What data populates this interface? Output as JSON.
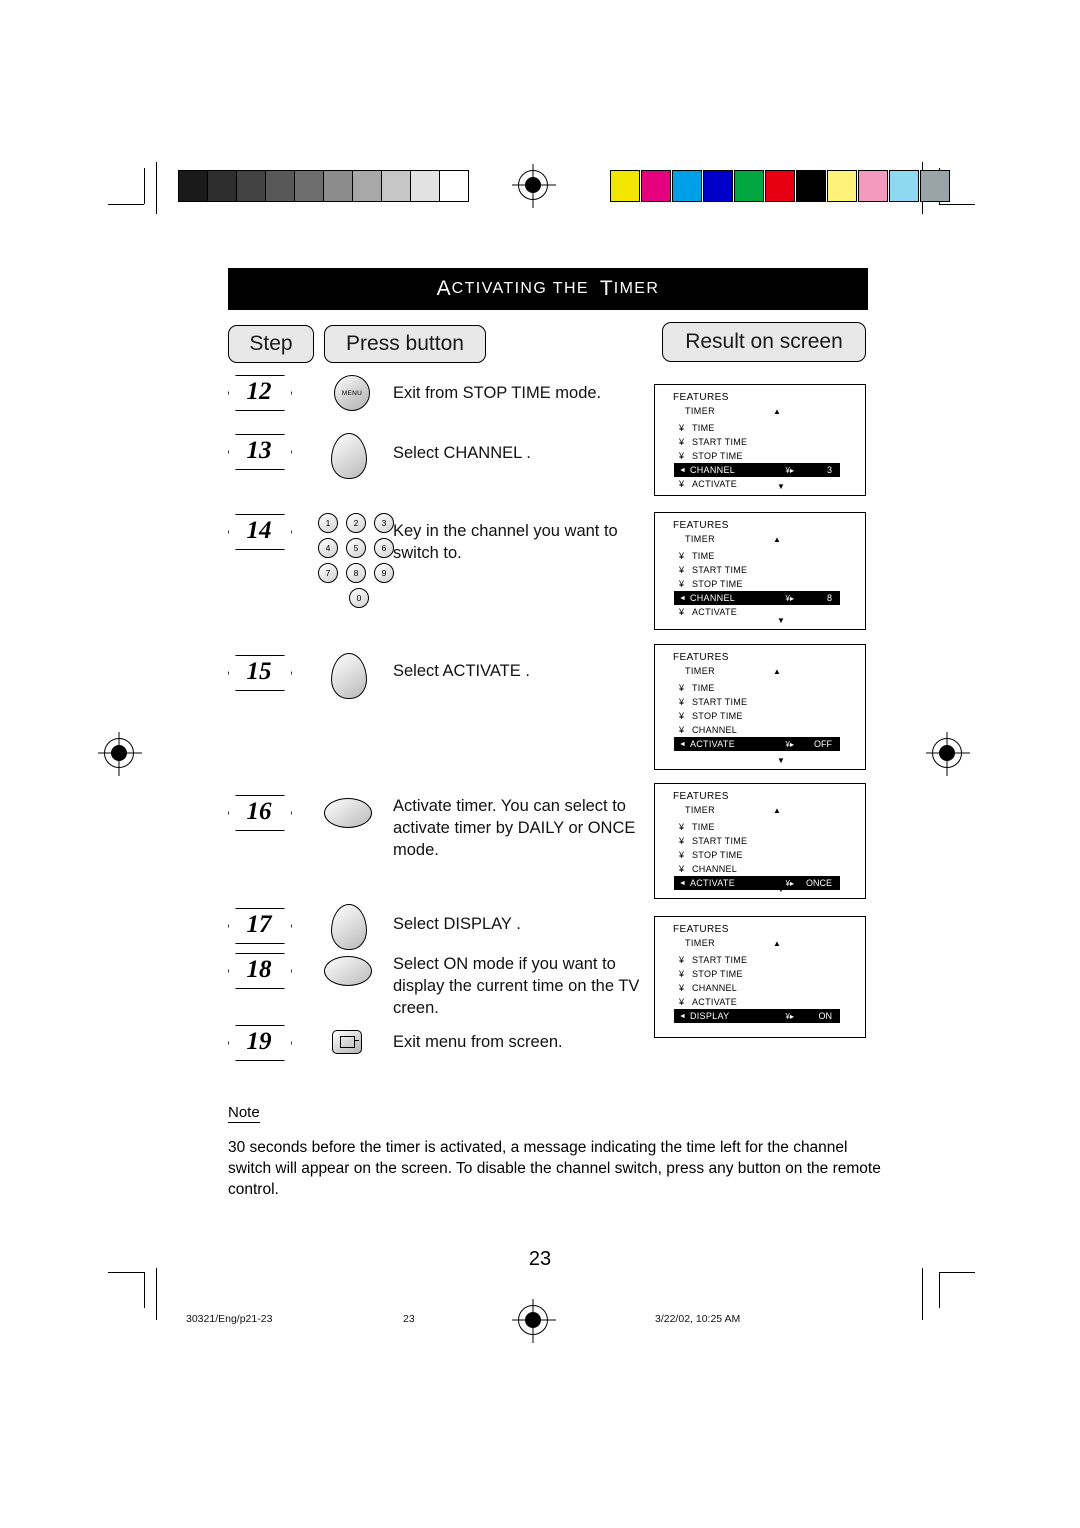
{
  "document": {
    "title": "ACTIVATING THE TIMER",
    "title_parts": {
      "a": "A",
      "ctivating": "CTIVATING  THE",
      "t": "T",
      "imer": "IMER"
    },
    "page_number": "23",
    "footer": {
      "left": "30321/Eng/p21-23",
      "center": "23",
      "right": "3/22/02, 10:25 AM"
    }
  },
  "headers": {
    "step": "Step",
    "press_button": "Press button",
    "result": "Result on screen"
  },
  "steps": [
    {
      "num": "12",
      "button": "MENU",
      "button_type": "menu-round",
      "text": "Exit from STOP TIME  mode."
    },
    {
      "num": "13",
      "button": "",
      "button_type": "oval",
      "text": "Select CHANNEL ."
    },
    {
      "num": "14",
      "button": "",
      "button_type": "keypad",
      "text": "Key in the channel you want to switch to."
    },
    {
      "num": "15",
      "button": "",
      "button_type": "oval",
      "text": "Select ACTIVATE ."
    },
    {
      "num": "16",
      "button": "",
      "button_type": "wide",
      "text": "Activate timer. You can select to activate timer by DAILY  or ONCE  mode."
    },
    {
      "num": "17",
      "button": "",
      "button_type": "oval",
      "text": "Select DISPLAY ."
    },
    {
      "num": "18",
      "button": "",
      "button_type": "wide",
      "text": "Select ON  mode if you want to display the current time on the TV creen."
    },
    {
      "num": "19",
      "button": "",
      "button_type": "exit",
      "text": "Exit menu from screen."
    }
  ],
  "keypad": {
    "rows": [
      [
        "1",
        "2",
        "3"
      ],
      [
        "4",
        "5",
        "6"
      ],
      [
        "7",
        "8",
        "9"
      ],
      [
        "0"
      ]
    ]
  },
  "osd_screens": [
    {
      "features": "FEATURES",
      "timer": "TIMER",
      "rows": [
        {
          "label": "TIME",
          "selected": false
        },
        {
          "label": "START TIME",
          "selected": false
        },
        {
          "label": "STOP TIME",
          "selected": false
        },
        {
          "label": "CHANNEL",
          "selected": true,
          "value": "3"
        },
        {
          "label": "ACTIVATE",
          "selected": false
        }
      ],
      "has_up_arrow": true,
      "has_down_arrow": true
    },
    {
      "features": "FEATURES",
      "timer": "TIMER",
      "rows": [
        {
          "label": "TIME",
          "selected": false
        },
        {
          "label": "START TIME",
          "selected": false
        },
        {
          "label": "STOP TIME",
          "selected": false
        },
        {
          "label": "CHANNEL",
          "selected": true,
          "value": "8"
        },
        {
          "label": "ACTIVATE",
          "selected": false
        }
      ],
      "has_up_arrow": true,
      "has_down_arrow": true
    },
    {
      "features": "FEATURES",
      "timer": "TIMER",
      "rows": [
        {
          "label": "TIME",
          "selected": false
        },
        {
          "label": "START TIME",
          "selected": false
        },
        {
          "label": "STOP TIME",
          "selected": false
        },
        {
          "label": "CHANNEL",
          "selected": false
        },
        {
          "label": "ACTIVATE",
          "selected": true,
          "value": "OFF"
        }
      ],
      "has_up_arrow": true,
      "has_down_arrow": true
    },
    {
      "features": "FEATURES",
      "timer": "TIMER",
      "rows": [
        {
          "label": "TIME",
          "selected": false
        },
        {
          "label": "START TIME",
          "selected": false
        },
        {
          "label": "STOP TIME",
          "selected": false
        },
        {
          "label": "CHANNEL",
          "selected": false
        },
        {
          "label": "ACTIVATE",
          "selected": true,
          "value": "ONCE"
        }
      ],
      "has_up_arrow": true,
      "has_down_arrow": true
    },
    {
      "features": "FEATURES",
      "timer": "TIMER",
      "rows": [
        {
          "label": "START TIME",
          "selected": false
        },
        {
          "label": "STOP TIME",
          "selected": false
        },
        {
          "label": "CHANNEL",
          "selected": false
        },
        {
          "label": "ACTIVATE",
          "selected": false
        },
        {
          "label": "DISPLAY",
          "selected": true,
          "value": "ON"
        }
      ],
      "has_up_arrow": true,
      "has_down_arrow": false
    }
  ],
  "note": {
    "heading": "Note",
    "body": "30 seconds before the timer is activated, a message indicating the time left for the channel switch will appear on the screen. To disable the channel switch, press any button on the remote control."
  },
  "colors": {
    "grayscale_bars": [
      "#1a1a1a",
      "#2e2e2e",
      "#434343",
      "#585858",
      "#6e6e6e",
      "#8c8c8c",
      "#a8a8a8",
      "#c6c6c6",
      "#e2e2e2",
      "#ffffff"
    ],
    "color_bars": [
      "#f2e500",
      "#e5007d",
      "#00a0e9",
      "#0000c8",
      "#00a63f",
      "#e60012",
      "#000000",
      "#fff27a",
      "#f49ac1",
      "#8fd8f2",
      "#9aa3a8"
    ]
  }
}
